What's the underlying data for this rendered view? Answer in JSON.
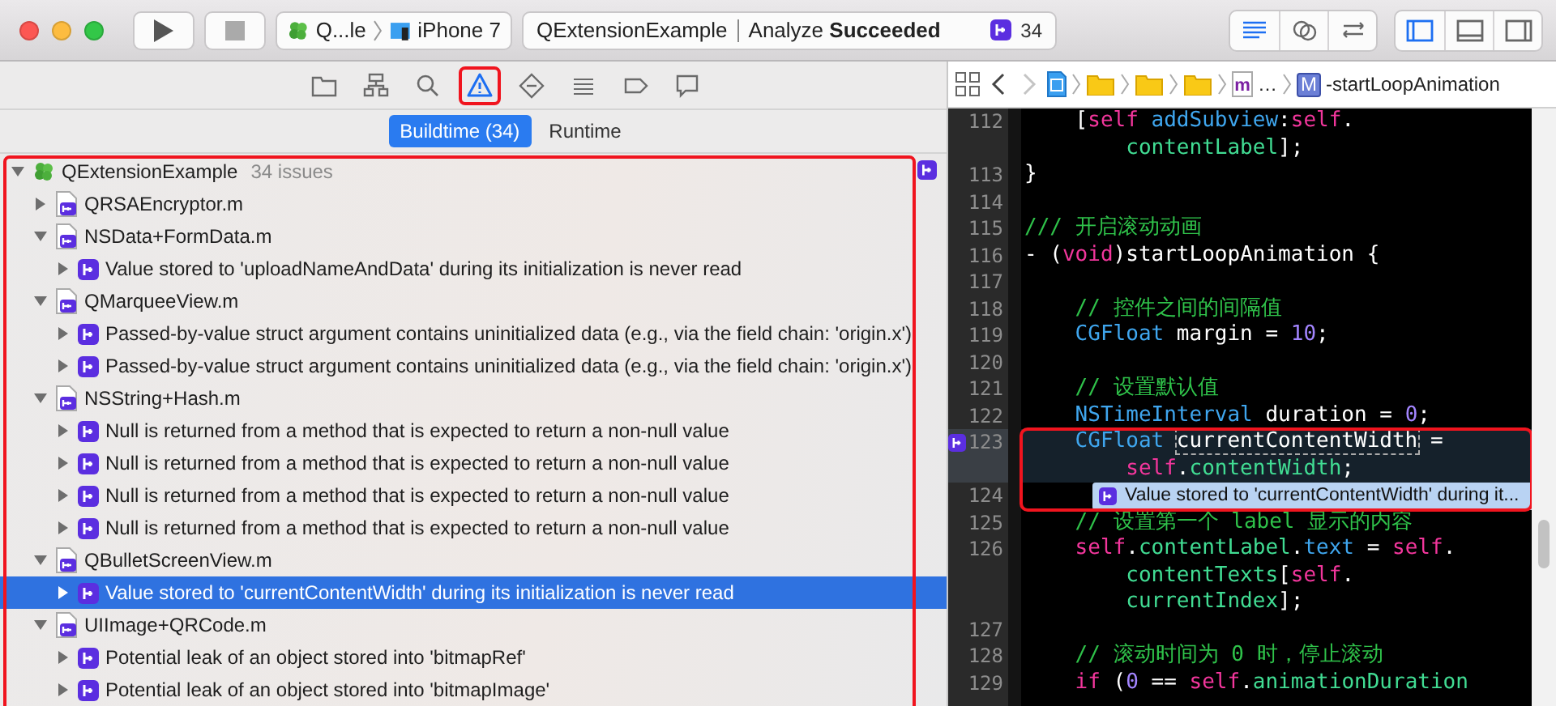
{
  "toolbar": {
    "scheme": {
      "name": "Q...le",
      "device": "iPhone 7"
    },
    "activity": {
      "project": "QExtensionExample",
      "status": "Analyze **Succeeded**",
      "issue_count": "34"
    },
    "editor_modes": [
      {
        "kind": "standard",
        "selected": true
      },
      {
        "kind": "assistant",
        "selected": false
      },
      {
        "kind": "version",
        "selected": false
      }
    ],
    "panels": [
      {
        "kind": "navigator",
        "on": true
      },
      {
        "kind": "debug",
        "on": false
      },
      {
        "kind": "utilities",
        "on": false
      }
    ]
  },
  "navigator": {
    "tabs": [
      {
        "kind": "files",
        "selected": false,
        "highlighted": false
      },
      {
        "kind": "symbols",
        "selected": false,
        "highlighted": false
      },
      {
        "kind": "find",
        "selected": false,
        "highlighted": false
      },
      {
        "kind": "issues",
        "selected": true,
        "highlighted": true
      },
      {
        "kind": "tests",
        "selected": false,
        "highlighted": false
      },
      {
        "kind": "debug",
        "selected": false,
        "highlighted": false
      },
      {
        "kind": "breakpoints",
        "selected": false,
        "highlighted": false
      },
      {
        "kind": "reports",
        "selected": false,
        "highlighted": false
      }
    ],
    "segments": [
      {
        "label": "Buildtime (34)",
        "selected": true
      },
      {
        "label": "Runtime",
        "selected": false
      }
    ],
    "issues": {
      "highlighted": true,
      "project": {
        "name": "QExtensionExample",
        "count": "34 issues",
        "expanded": true,
        "files": [
          {
            "name": "QRSAEncryptor.m",
            "expanded": false
          },
          {
            "name": "NSData+FormData.m",
            "expanded": true,
            "issues": [
              {
                "text": "Value stored to 'uploadNameAndData' during its initialization is never read",
                "selected": false
              }
            ]
          },
          {
            "name": "QMarqueeView.m",
            "expanded": true,
            "issues": [
              {
                "text": "Passed-by-value struct argument contains uninitialized data (e.g., via the field chain: 'origin.x')",
                "selected": false
              },
              {
                "text": "Passed-by-value struct argument contains uninitialized data (e.g., via the field chain: 'origin.x')",
                "selected": false
              }
            ]
          },
          {
            "name": "NSString+Hash.m",
            "expanded": true,
            "issues": [
              {
                "text": "Null is returned from a method that is expected to return a non-null value",
                "selected": false
              },
              {
                "text": "Null is returned from a method that is expected to return a non-null value",
                "selected": false
              },
              {
                "text": "Null is returned from a method that is expected to return a non-null value",
                "selected": false
              },
              {
                "text": "Null is returned from a method that is expected to return a non-null value",
                "selected": false
              }
            ]
          },
          {
            "name": "QBulletScreenView.m",
            "expanded": true,
            "issues": [
              {
                "text": "Value stored to 'currentContentWidth' during its initialization is never read",
                "selected": true
              }
            ]
          },
          {
            "name": "UIImage+QRCode.m",
            "expanded": true,
            "issues": [
              {
                "text": "Potential leak of an object stored into 'bitmapRef'",
                "selected": false
              },
              {
                "text": "Potential leak of an object stored into 'bitmapImage'",
                "selected": false
              }
            ]
          }
        ]
      }
    }
  },
  "editor": {
    "nav": [
      {
        "kind": "back",
        "disabled": false
      },
      {
        "kind": "forward",
        "disabled": true
      }
    ],
    "path": [
      {
        "kind": "project"
      },
      {
        "kind": "folder"
      },
      {
        "kind": "folder"
      },
      {
        "kind": "folder"
      },
      {
        "kind": "file",
        "glyph": "m",
        "label": "…"
      },
      {
        "kind": "method",
        "glyph": "M",
        "label": "-startLoopAnimation"
      }
    ],
    "lines": [
      {
        "number": "112",
        "current": false,
        "marker": false,
        "highlighted": false,
        "tokens": [
          {
            "kind": "plain",
            "text": "    ["
          },
          {
            "kind": "keyword",
            "text": "self"
          },
          {
            "kind": "method",
            "text": " addSubview"
          },
          {
            "kind": "plain",
            "text": ":"
          },
          {
            "kind": "keyword",
            "text": "self"
          },
          {
            "kind": "plain",
            "text": "."
          },
          {
            "kind": "property",
            "text": "        contentLabel",
            "wrap": true
          },
          {
            "kind": "plain",
            "text": "];"
          }
        ]
      },
      {
        "number": "113",
        "current": false,
        "marker": false,
        "highlighted": false,
        "tokens": [
          {
            "kind": "plain",
            "text": "}"
          }
        ]
      },
      {
        "number": "114",
        "current": false,
        "marker": false,
        "highlighted": false
      },
      {
        "number": "115",
        "current": false,
        "marker": false,
        "highlighted": false,
        "tokens": [
          {
            "kind": "comment",
            "text": "/// 开启滚动动画"
          }
        ]
      },
      {
        "number": "116",
        "current": false,
        "marker": false,
        "highlighted": false,
        "tokens": [
          {
            "kind": "plain",
            "text": "- ("
          },
          {
            "kind": "keyword",
            "text": "void"
          },
          {
            "kind": "plain",
            "text": ")startLoopAnimation {"
          }
        ]
      },
      {
        "number": "117",
        "current": false,
        "marker": false,
        "highlighted": false
      },
      {
        "number": "118",
        "current": false,
        "marker": false,
        "highlighted": false,
        "tokens": [
          {
            "kind": "comment",
            "text": "    // 控件之间的间隔值"
          }
        ]
      },
      {
        "number": "119",
        "current": false,
        "marker": false,
        "highlighted": false,
        "tokens": [
          {
            "kind": "type",
            "text": "    CGFloat"
          },
          {
            "kind": "plain",
            "text": " margin = "
          },
          {
            "kind": "number",
            "text": "10"
          },
          {
            "kind": "plain",
            "text": ";"
          }
        ]
      },
      {
        "number": "120",
        "current": false,
        "marker": false,
        "highlighted": false
      },
      {
        "number": "121",
        "current": false,
        "marker": false,
        "highlighted": false,
        "tokens": [
          {
            "kind": "comment",
            "text": "    // 设置默认值"
          }
        ]
      },
      {
        "number": "122",
        "current": false,
        "marker": false,
        "highlighted": false,
        "tokens": [
          {
            "kind": "type",
            "text": "    NSTimeInterval"
          },
          {
            "kind": "plain",
            "text": " duration = "
          },
          {
            "kind": "number",
            "text": "0"
          },
          {
            "kind": "plain",
            "text": ";"
          }
        ]
      },
      {
        "number": "123",
        "current": true,
        "marker": true,
        "highlighted": true,
        "tokens": [
          {
            "kind": "type",
            "text": "    CGFloat "
          },
          {
            "kind": "flagged",
            "text": "currentContentWidth"
          },
          {
            "kind": "plain",
            "text": " ="
          },
          {
            "kind": "keyword",
            "text": "        self",
            "wrap": true
          },
          {
            "kind": "plain",
            "text": "."
          },
          {
            "kind": "property",
            "text": "contentWidth"
          },
          {
            "kind": "plain",
            "text": ";"
          }
        ]
      },
      {
        "number": "124",
        "current": false,
        "marker": false,
        "highlighted": true,
        "annotation": "Value stored to 'currentContentWidth' during it..."
      },
      {
        "number": "125",
        "current": false,
        "marker": false,
        "highlighted": false,
        "tokens": [
          {
            "kind": "comment",
            "text": "    // 设置第一个 label 显示的内容"
          }
        ]
      },
      {
        "number": "126",
        "current": false,
        "marker": false,
        "highlighted": false,
        "tokens": [
          {
            "kind": "keyword",
            "text": "    self"
          },
          {
            "kind": "plain",
            "text": "."
          },
          {
            "kind": "property",
            "text": "contentLabel"
          },
          {
            "kind": "plain",
            "text": "."
          },
          {
            "kind": "method",
            "text": "text"
          },
          {
            "kind": "plain",
            "text": " = "
          },
          {
            "kind": "keyword",
            "text": "self"
          },
          {
            "kind": "plain",
            "text": "."
          },
          {
            "kind": "property",
            "text": "        contentTexts",
            "wrap": true
          },
          {
            "kind": "plain",
            "text": "["
          },
          {
            "kind": "keyword",
            "text": "self"
          },
          {
            "kind": "plain",
            "text": "."
          },
          {
            "kind": "property",
            "text": "        currentIndex",
            "wrap": true
          },
          {
            "kind": "plain",
            "text": "];"
          }
        ]
      },
      {
        "number": "127",
        "current": false,
        "marker": false,
        "highlighted": false
      },
      {
        "number": "128",
        "current": false,
        "marker": false,
        "highlighted": false,
        "tokens": [
          {
            "kind": "comment",
            "text": "    // 滚动时间为 0 时，停止滚动"
          }
        ]
      },
      {
        "number": "129",
        "current": false,
        "marker": false,
        "highlighted": false,
        "tokens": [
          {
            "kind": "keyword",
            "text": "    if"
          },
          {
            "kind": "plain",
            "text": " ("
          },
          {
            "kind": "number",
            "text": "0"
          },
          {
            "kind": "plain",
            "text": " == "
          },
          {
            "kind": "keyword",
            "text": "self"
          },
          {
            "kind": "plain",
            "text": "."
          },
          {
            "kind": "property",
            "text": "animationDuration"
          }
        ]
      }
    ]
  }
}
